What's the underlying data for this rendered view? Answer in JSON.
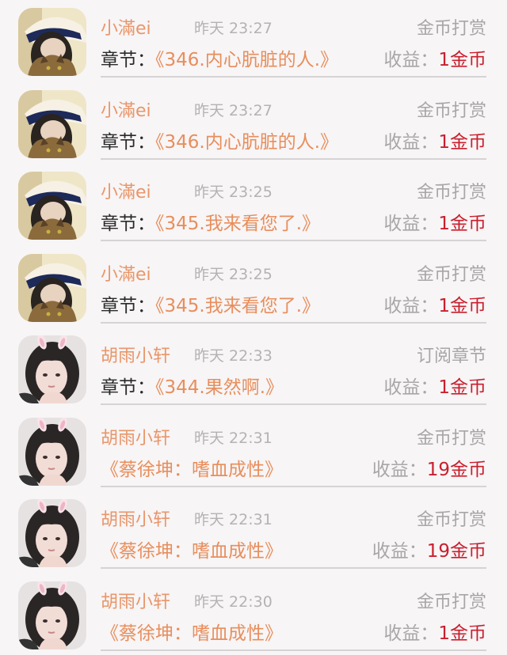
{
  "labels": {
    "chapter_prefix": "章节：",
    "earnings_prefix": "收益：",
    "currency_unit": "金币"
  },
  "colors": {
    "username": "#e9966a",
    "chapter_title": "#e88e5c",
    "earnings_value": "#c8202e",
    "muted_text": "#a9a6a7",
    "background": "#f7f5f6"
  },
  "records": [
    {
      "avatar": "user-avatar-cat",
      "name": "小滿ei",
      "time": "昨天 23:27",
      "type": "金币打赏",
      "chapter": "《346.内心肮脏的人.》",
      "amount": "1"
    },
    {
      "avatar": "user-avatar-cat",
      "name": "小滿ei",
      "time": "昨天 23:27",
      "type": "金币打赏",
      "chapter": "《346.内心肮脏的人.》",
      "amount": "1"
    },
    {
      "avatar": "user-avatar-cat",
      "name": "小滿ei",
      "time": "昨天 23:25",
      "type": "金币打赏",
      "chapter": "《345.我来看您了.》",
      "amount": "1"
    },
    {
      "avatar": "user-avatar-cat",
      "name": "小滿ei",
      "time": "昨天 23:25",
      "type": "金币打赏",
      "chapter": "《345.我来看您了.》",
      "amount": "1"
    },
    {
      "avatar": "user-avatar-bunny",
      "name": "胡雨小轩",
      "time": "昨天 22:33",
      "type": "订阅章节",
      "chapter": "《344.果然啊.》",
      "amount": "1"
    },
    {
      "avatar": "user-avatar-bunny",
      "name": "胡雨小轩",
      "time": "昨天 22:31",
      "type": "金币打赏",
      "chapter": "《蔡徐坤：嗜血成性》",
      "amount": "19"
    },
    {
      "avatar": "user-avatar-bunny",
      "name": "胡雨小轩",
      "time": "昨天 22:31",
      "type": "金币打赏",
      "chapter": "《蔡徐坤：嗜血成性》",
      "amount": "19"
    },
    {
      "avatar": "user-avatar-bunny",
      "name": "胡雨小轩",
      "time": "昨天 22:30",
      "type": "金币打赏",
      "chapter": "《蔡徐坤：嗜血成性》",
      "amount": "1"
    }
  ]
}
